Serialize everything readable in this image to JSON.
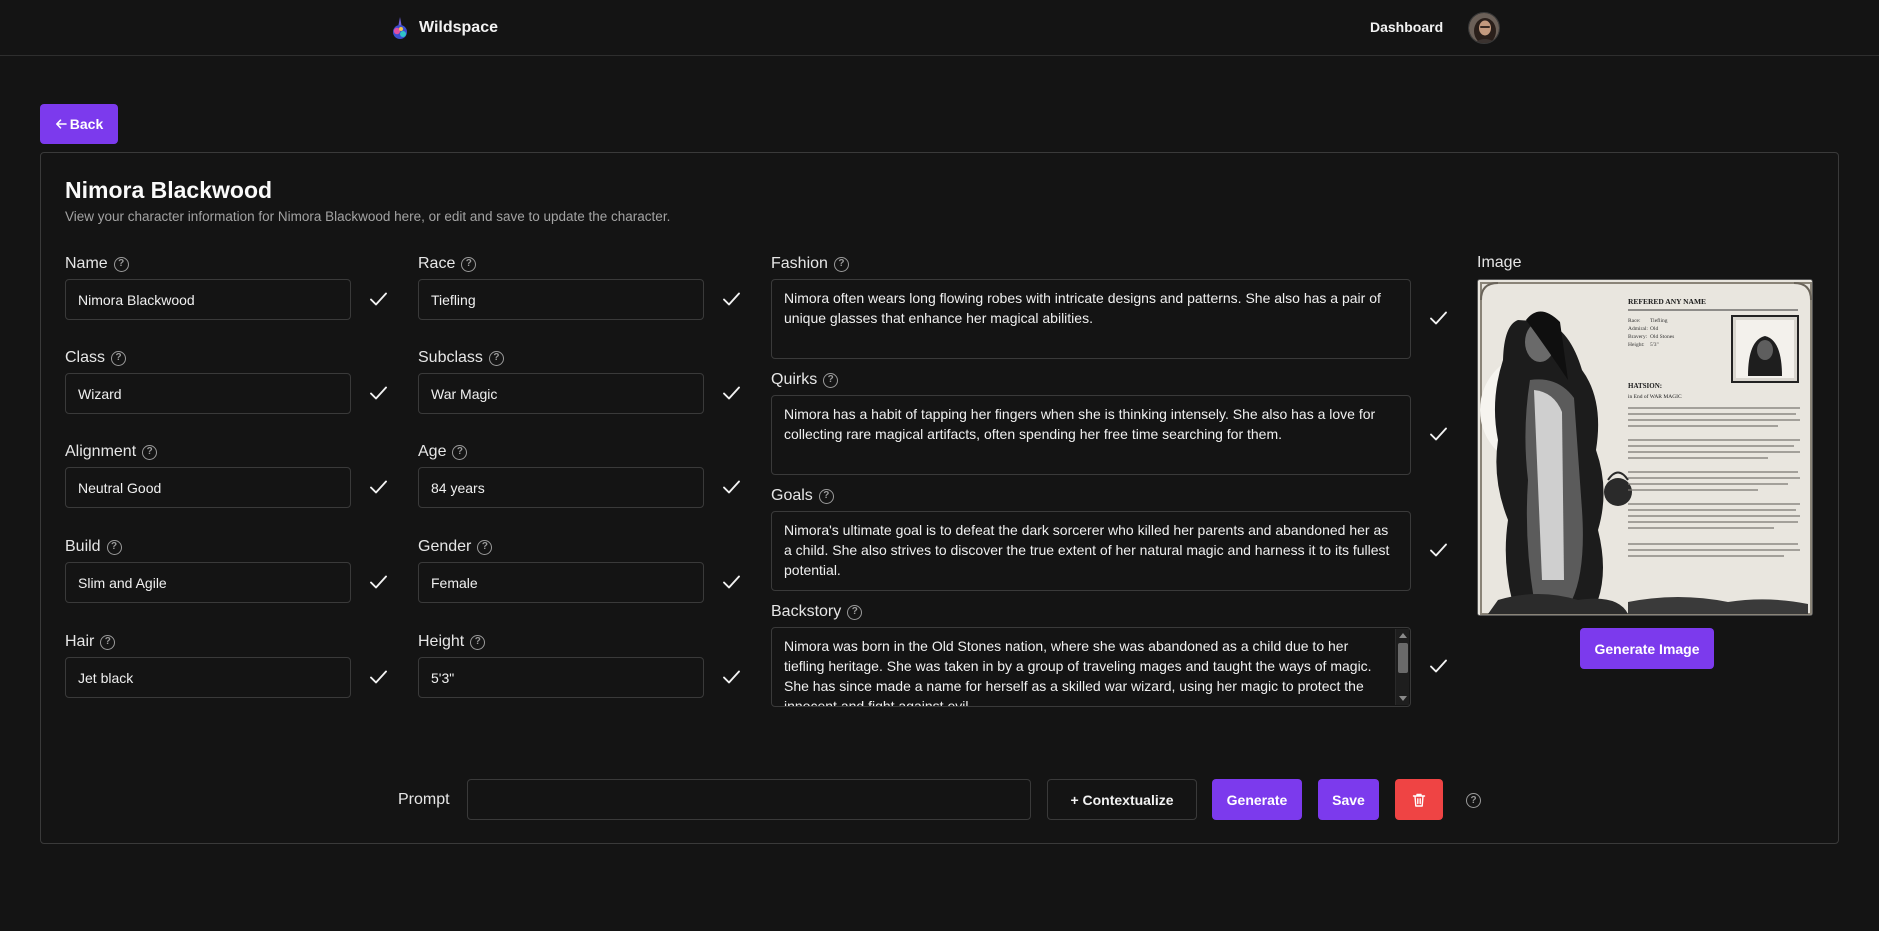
{
  "app": {
    "name": "Wildspace"
  },
  "nav": {
    "dashboard": "Dashboard"
  },
  "back_label": "Back",
  "character": {
    "title": "Nimora Blackwood",
    "description": "View your character information for Nimora Blackwood here, or edit and save to update the character."
  },
  "fields": {
    "name": {
      "label": "Name",
      "value": "Nimora Blackwood"
    },
    "race": {
      "label": "Race",
      "value": "Tiefling"
    },
    "class": {
      "label": "Class",
      "value": "Wizard"
    },
    "subclass": {
      "label": "Subclass",
      "value": "War Magic"
    },
    "alignment": {
      "label": "Alignment",
      "value": "Neutral Good"
    },
    "age": {
      "label": "Age",
      "value": "84 years"
    },
    "build": {
      "label": "Build",
      "value": "Slim and Agile"
    },
    "gender": {
      "label": "Gender",
      "value": "Female"
    },
    "hair": {
      "label": "Hair",
      "value": "Jet black"
    },
    "height": {
      "label": "Height",
      "value": "5'3\""
    }
  },
  "texts": {
    "fashion": {
      "label": "Fashion",
      "value": "Nimora often wears long flowing robes with intricate designs and patterns. She also has a pair of unique glasses that enhance her magical abilities."
    },
    "quirks": {
      "label": "Quirks",
      "value": "Nimora has a habit of tapping her fingers when she is thinking intensely. She also has a love for collecting rare magical artifacts, often spending her free time searching for them."
    },
    "goals": {
      "label": "Goals",
      "value": "Nimora's ultimate goal is to defeat the dark sorcerer who killed her parents and abandoned her as a child. She also strives to discover the true extent of her natural magic and harness it to its fullest potential."
    },
    "backstory": {
      "label": "Backstory",
      "value": "Nimora was born in the Old Stones nation, where she was abandoned as a child due to her tiefling heritage. She was taken in by a group of traveling mages and taught the ways of magic. She has since made a name for herself as a skilled war wizard, using her magic to protect the innocent and fight against evil."
    }
  },
  "image": {
    "label": "Image",
    "generate_label": "Generate Image",
    "sheet_heading": "REFERED ANY NAME",
    "sheet_rows": [
      "Race:",
      "Tiefling",
      "Admiral:",
      "Old",
      "Bravery:",
      "Old Stones",
      "Height:",
      "5'3\""
    ],
    "sheet_section": "HATSION:",
    "sheet_subsection": "in End of WAR MAGIC"
  },
  "prompt": {
    "label": "Prompt",
    "placeholder": "",
    "contextualize_label": "+ Contextualize",
    "generate_label": "Generate",
    "save_label": "Save"
  },
  "colors": {
    "accent": "#7c3aed",
    "danger": "#ef4444",
    "background": "#141414",
    "border": "#3a3a3a"
  },
  "icons": [
    "wildspace-logo-icon",
    "avatar",
    "arrow-left-icon",
    "help-icon",
    "check-icon",
    "trash-icon"
  ]
}
